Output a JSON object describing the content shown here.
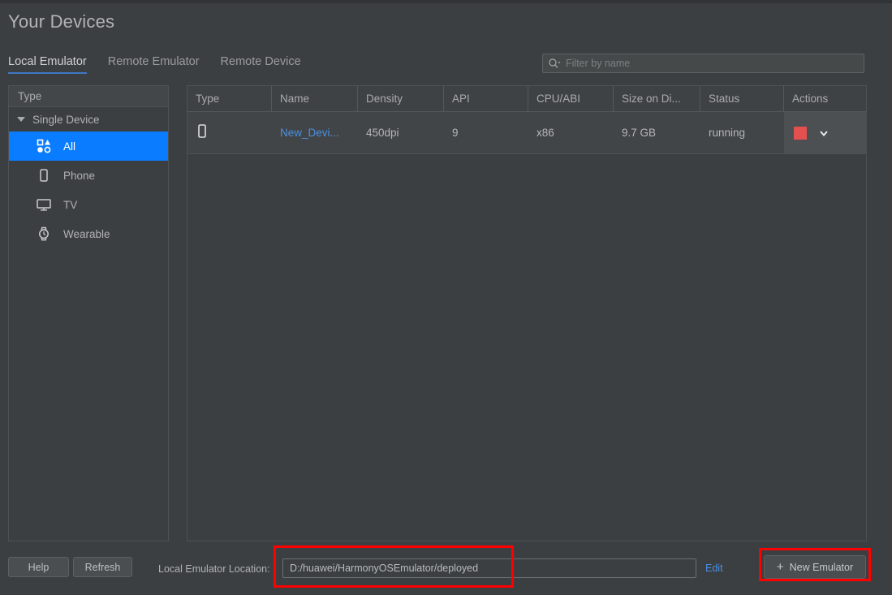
{
  "page_title": "Your Devices",
  "tabs": [
    {
      "label": "Local Emulator",
      "active": true
    },
    {
      "label": "Remote Emulator",
      "active": false
    },
    {
      "label": "Remote Device",
      "active": false
    }
  ],
  "filter": {
    "placeholder": "Filter by name",
    "value": "",
    "icon": "search-icon"
  },
  "sidebar": {
    "header": "Type",
    "group": {
      "label": "Single Device",
      "expanded": true
    },
    "items": [
      {
        "label": "All",
        "icon": "grid-shapes-icon",
        "selected": true
      },
      {
        "label": "Phone",
        "icon": "phone-icon",
        "selected": false
      },
      {
        "label": "TV",
        "icon": "tv-icon",
        "selected": false
      },
      {
        "label": "Wearable",
        "icon": "watch-icon",
        "selected": false
      }
    ]
  },
  "table": {
    "columns": [
      "Type",
      "Name",
      "Density",
      "API",
      "CPU/ABI",
      "Size on Di...",
      "Status",
      "Actions"
    ],
    "rows": [
      {
        "type_icon": "phone-icon",
        "name": "New_Devi...",
        "density": "450dpi",
        "api": "9",
        "cpu_abi": "x86",
        "size_on_disk": "9.7 GB",
        "status": "running",
        "actions": {
          "stop_icon": "stop-square-icon",
          "menu_icon": "chevron-down-icon"
        }
      }
    ]
  },
  "bottom": {
    "help_label": "Help",
    "refresh_label": "Refresh",
    "location_label": "Local Emulator Location:",
    "location_value": "D:/huawei/HarmonyOSEmulator/deployed",
    "edit_label": "Edit",
    "new_emulator_label": "New Emulator",
    "new_emulator_plus": "+"
  },
  "colors": {
    "background": "#3c3f41",
    "selection_blue": "#0a7cff",
    "link_blue": "#4a8fe0",
    "tab_underline": "#3f77c4",
    "status_stop_red": "#e4504f",
    "annotation_red": "#fe0000"
  }
}
